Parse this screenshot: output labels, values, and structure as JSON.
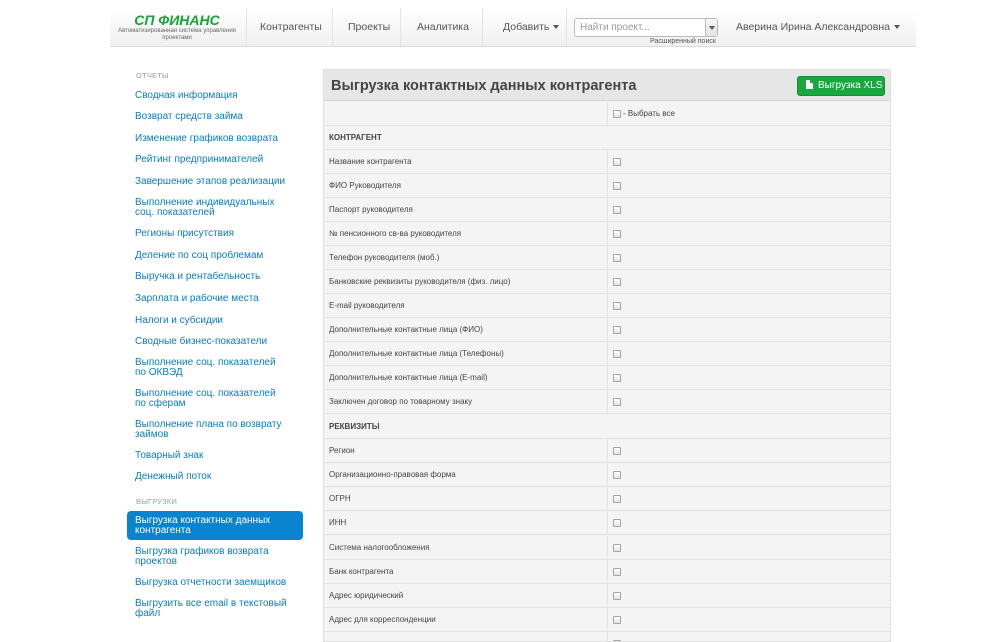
{
  "navbar": {
    "brand_title": "СП ФИНАНС",
    "brand_subtitle": "Автоматизированная система управления проектами",
    "links": [
      "Контрагенты",
      "Проекты",
      "Аналитика"
    ],
    "add_label": "Добавить",
    "search_placeholder": "Найти проект...",
    "advanced_search": "Расширенный поиск",
    "user_name": "Аверина Ирина Александровна"
  },
  "sidebar": {
    "reports_heading": "ОТЧЕТЫ",
    "reports": [
      "Сводная информация",
      "Возврат средств займа",
      "Изменение графиков возврата",
      "Рейтинг предпринимателей",
      "Завершение этапов реализации",
      "Выполнение индивидуальных соц. показателей",
      "Регионы присутствия",
      "Деление по соц проблемам",
      "Выручка и рентабельность",
      "Зарплата и рабочие места",
      "Налоги и субсидии",
      "Сводные бизнес-показатели",
      "Выполнение соц. показателей по ОКВЭД",
      "Выполнение соц. показателей по сферам",
      "Выполнение плана по возврату займов",
      "Товарный знак",
      "Денежный поток"
    ],
    "exports_heading": "ВЫГРУЗКИ",
    "exports": [
      "Выгрузка контактных данных контрагента",
      "Выгрузка графиков возврата проектов",
      "Выгрузка отчетности заемщиков",
      "Выгрузить все email в текстовый файл"
    ]
  },
  "main": {
    "title": "Выгрузка контактных данных контрагента",
    "export_button": "Выгрузка XLS",
    "select_all": "- Выбрать все",
    "section_counterparty": "КОНТРАГЕНТ",
    "counterparty_fields": [
      "Название контрагента",
      "ФИО Руководителя",
      "Паспорт руководителя",
      "№ пенсионного св-ва руководителя",
      "Телефон руководителя (моб.)",
      "Банковские реквизиты руководителя (физ. лицо)",
      "E-mail руководителя",
      "Дополнительные контактные лица (ФИО)",
      "Дополнительные контактные лица (Телефоны)",
      "Дополнительные контактные лица (E-mail)",
      "Заключен договор по товарному знаку"
    ],
    "section_requisites": "РЕКВИЗИТЫ",
    "requisites_fields": [
      "Регион",
      "Организационно-правовая форма",
      "ОГРН",
      "ИНН",
      "Система налогообложения",
      "Банк контрагента",
      "Адрес юридический",
      "Адрес для корреспонденции"
    ]
  },
  "colors": {
    "brand": "#17a336",
    "link": "#0a7cc1",
    "active": "#0a84d1",
    "button": "#19a840"
  }
}
